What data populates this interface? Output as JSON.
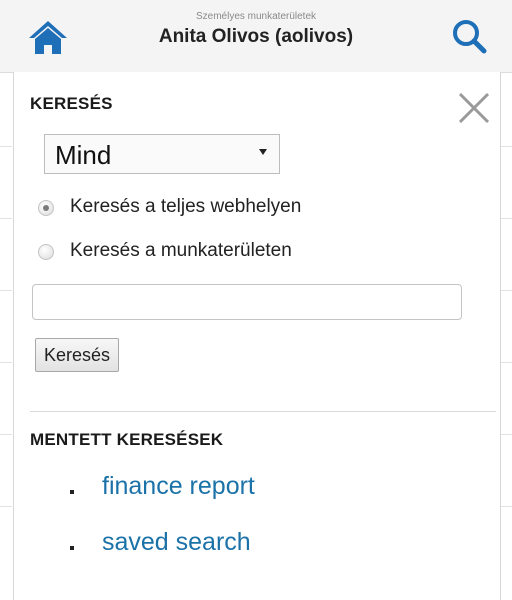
{
  "header": {
    "subtitle": "Személyes munkaterületek",
    "user": "Anita Olivos (aolivos)",
    "icons": {
      "home": "home-icon",
      "search": "search-icon"
    }
  },
  "panel": {
    "search_heading": "KERESÉS",
    "close_icon": "close-icon",
    "scope_select": {
      "selected": "Mind"
    },
    "radios": [
      {
        "label": "Keresés a teljes webhelyen",
        "checked": true
      },
      {
        "label": "Keresés a munkaterületen",
        "checked": false
      }
    ],
    "search_input": {
      "value": "",
      "placeholder": ""
    },
    "search_button": "Keresés",
    "saved_heading": "MENTETT KERESÉSEK",
    "saved_searches": [
      "finance report",
      "saved search"
    ]
  },
  "colors": {
    "accent": "#1a72a8",
    "icon_blue": "#1e6fb8"
  }
}
